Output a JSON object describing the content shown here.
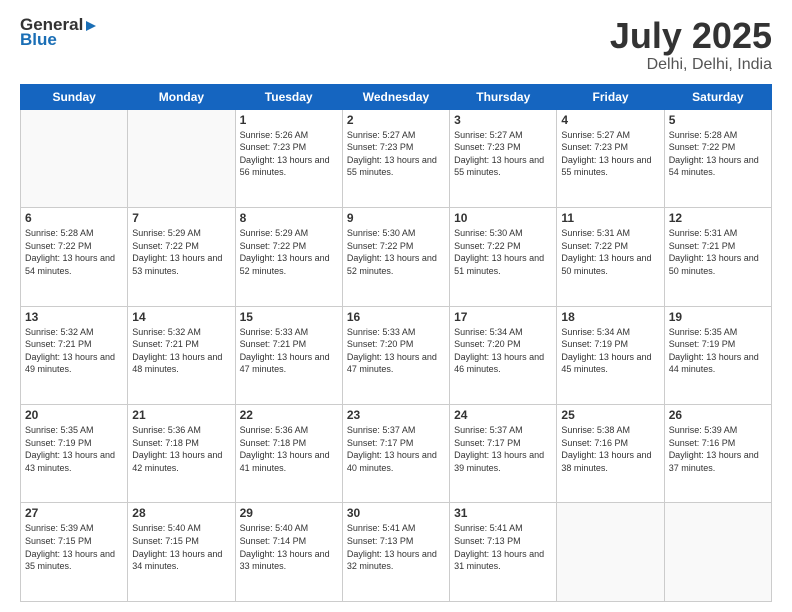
{
  "header": {
    "logo_general": "General",
    "logo_blue": "Blue",
    "month": "July 2025",
    "location": "Delhi, Delhi, India"
  },
  "days_of_week": [
    "Sunday",
    "Monday",
    "Tuesday",
    "Wednesday",
    "Thursday",
    "Friday",
    "Saturday"
  ],
  "weeks": [
    [
      {
        "day": "",
        "info": ""
      },
      {
        "day": "",
        "info": ""
      },
      {
        "day": "1",
        "info": "Sunrise: 5:26 AM\nSunset: 7:23 PM\nDaylight: 13 hours and 56 minutes."
      },
      {
        "day": "2",
        "info": "Sunrise: 5:27 AM\nSunset: 7:23 PM\nDaylight: 13 hours and 55 minutes."
      },
      {
        "day": "3",
        "info": "Sunrise: 5:27 AM\nSunset: 7:23 PM\nDaylight: 13 hours and 55 minutes."
      },
      {
        "day": "4",
        "info": "Sunrise: 5:27 AM\nSunset: 7:23 PM\nDaylight: 13 hours and 55 minutes."
      },
      {
        "day": "5",
        "info": "Sunrise: 5:28 AM\nSunset: 7:22 PM\nDaylight: 13 hours and 54 minutes."
      }
    ],
    [
      {
        "day": "6",
        "info": "Sunrise: 5:28 AM\nSunset: 7:22 PM\nDaylight: 13 hours and 54 minutes."
      },
      {
        "day": "7",
        "info": "Sunrise: 5:29 AM\nSunset: 7:22 PM\nDaylight: 13 hours and 53 minutes."
      },
      {
        "day": "8",
        "info": "Sunrise: 5:29 AM\nSunset: 7:22 PM\nDaylight: 13 hours and 52 minutes."
      },
      {
        "day": "9",
        "info": "Sunrise: 5:30 AM\nSunset: 7:22 PM\nDaylight: 13 hours and 52 minutes."
      },
      {
        "day": "10",
        "info": "Sunrise: 5:30 AM\nSunset: 7:22 PM\nDaylight: 13 hours and 51 minutes."
      },
      {
        "day": "11",
        "info": "Sunrise: 5:31 AM\nSunset: 7:22 PM\nDaylight: 13 hours and 50 minutes."
      },
      {
        "day": "12",
        "info": "Sunrise: 5:31 AM\nSunset: 7:21 PM\nDaylight: 13 hours and 50 minutes."
      }
    ],
    [
      {
        "day": "13",
        "info": "Sunrise: 5:32 AM\nSunset: 7:21 PM\nDaylight: 13 hours and 49 minutes."
      },
      {
        "day": "14",
        "info": "Sunrise: 5:32 AM\nSunset: 7:21 PM\nDaylight: 13 hours and 48 minutes."
      },
      {
        "day": "15",
        "info": "Sunrise: 5:33 AM\nSunset: 7:21 PM\nDaylight: 13 hours and 47 minutes."
      },
      {
        "day": "16",
        "info": "Sunrise: 5:33 AM\nSunset: 7:20 PM\nDaylight: 13 hours and 47 minutes."
      },
      {
        "day": "17",
        "info": "Sunrise: 5:34 AM\nSunset: 7:20 PM\nDaylight: 13 hours and 46 minutes."
      },
      {
        "day": "18",
        "info": "Sunrise: 5:34 AM\nSunset: 7:19 PM\nDaylight: 13 hours and 45 minutes."
      },
      {
        "day": "19",
        "info": "Sunrise: 5:35 AM\nSunset: 7:19 PM\nDaylight: 13 hours and 44 minutes."
      }
    ],
    [
      {
        "day": "20",
        "info": "Sunrise: 5:35 AM\nSunset: 7:19 PM\nDaylight: 13 hours and 43 minutes."
      },
      {
        "day": "21",
        "info": "Sunrise: 5:36 AM\nSunset: 7:18 PM\nDaylight: 13 hours and 42 minutes."
      },
      {
        "day": "22",
        "info": "Sunrise: 5:36 AM\nSunset: 7:18 PM\nDaylight: 13 hours and 41 minutes."
      },
      {
        "day": "23",
        "info": "Sunrise: 5:37 AM\nSunset: 7:17 PM\nDaylight: 13 hours and 40 minutes."
      },
      {
        "day": "24",
        "info": "Sunrise: 5:37 AM\nSunset: 7:17 PM\nDaylight: 13 hours and 39 minutes."
      },
      {
        "day": "25",
        "info": "Sunrise: 5:38 AM\nSunset: 7:16 PM\nDaylight: 13 hours and 38 minutes."
      },
      {
        "day": "26",
        "info": "Sunrise: 5:39 AM\nSunset: 7:16 PM\nDaylight: 13 hours and 37 minutes."
      }
    ],
    [
      {
        "day": "27",
        "info": "Sunrise: 5:39 AM\nSunset: 7:15 PM\nDaylight: 13 hours and 35 minutes."
      },
      {
        "day": "28",
        "info": "Sunrise: 5:40 AM\nSunset: 7:15 PM\nDaylight: 13 hours and 34 minutes."
      },
      {
        "day": "29",
        "info": "Sunrise: 5:40 AM\nSunset: 7:14 PM\nDaylight: 13 hours and 33 minutes."
      },
      {
        "day": "30",
        "info": "Sunrise: 5:41 AM\nSunset: 7:13 PM\nDaylight: 13 hours and 32 minutes."
      },
      {
        "day": "31",
        "info": "Sunrise: 5:41 AM\nSunset: 7:13 PM\nDaylight: 13 hours and 31 minutes."
      },
      {
        "day": "",
        "info": ""
      },
      {
        "day": "",
        "info": ""
      }
    ]
  ]
}
